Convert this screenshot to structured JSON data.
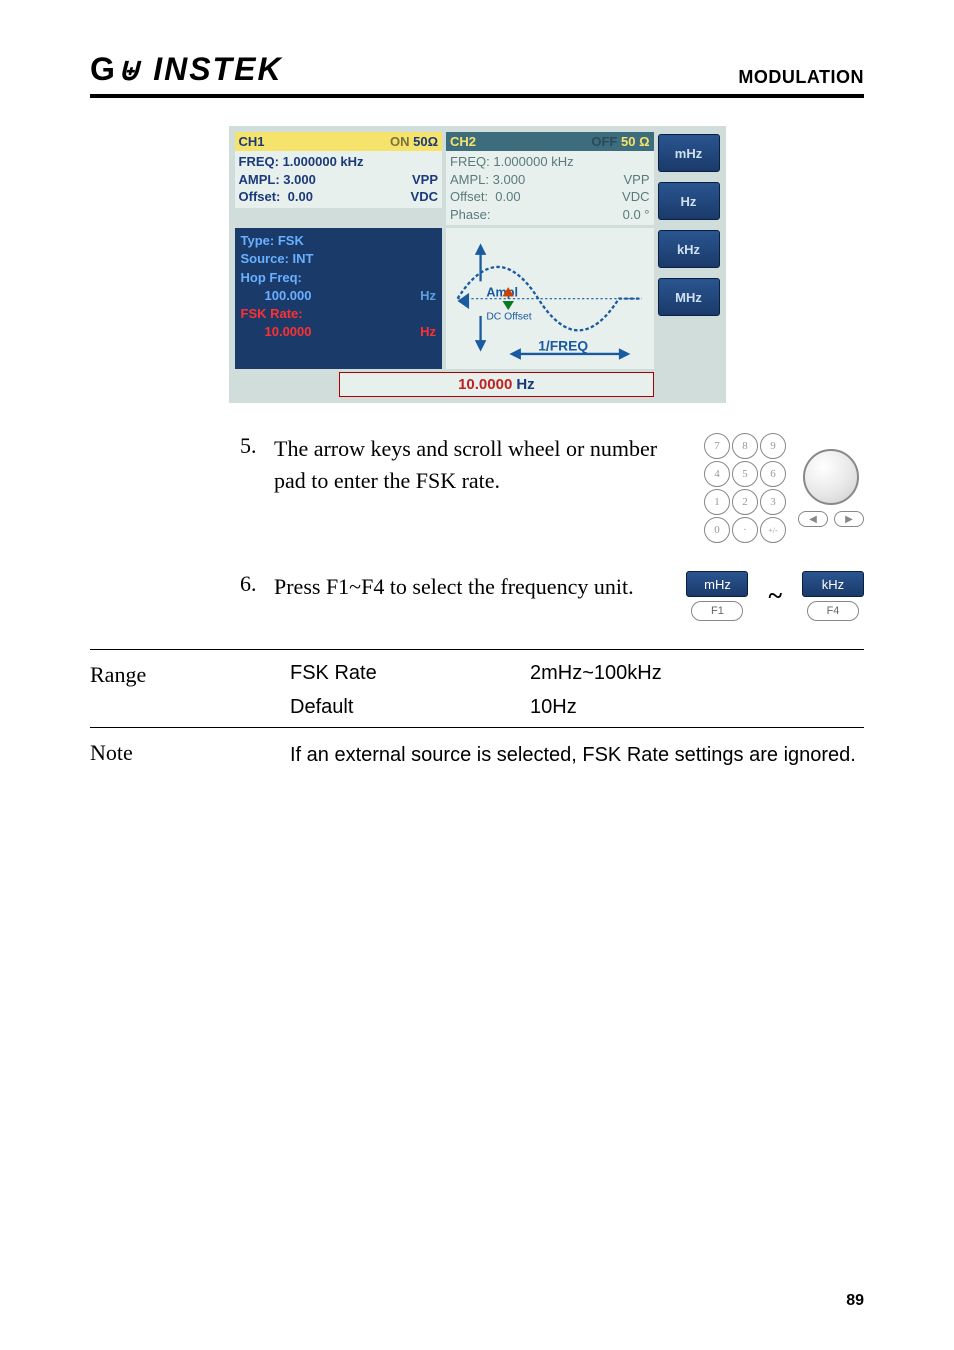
{
  "header": {
    "logo": "GWINSTEK",
    "title": "MODULATION"
  },
  "screenshot": {
    "ch1": {
      "head_label": "CH1",
      "head_on": "ON",
      "head_imp": "50Ω",
      "freq_label": "FREQ:",
      "freq_val": "1.000000 kHz",
      "ampl_label": "AMPL:",
      "ampl_val": "3.000",
      "ampl_unit": "VPP",
      "offset_label": "Offset:",
      "offset_val": "0.00",
      "offset_unit": "VDC"
    },
    "ch2": {
      "head_label": "CH2",
      "head_off": "OFF",
      "head_imp": "50 Ω",
      "freq_label": "FREQ:",
      "freq_val": "1.000000 kHz",
      "ampl_label": "AMPL:",
      "ampl_val": "3.000",
      "ampl_unit": "VPP",
      "offset_label": "Offset:",
      "offset_val": "0.00",
      "offset_unit": "VDC",
      "phase_label": "Phase:",
      "phase_val": "0.0 °"
    },
    "mod": {
      "type_label": "Type:",
      "type_val": "FSK",
      "src_label": "Source:",
      "src_val": "INT",
      "hop_label": "Hop Freq:",
      "hop_val": "100.000",
      "hop_unit": "Hz",
      "rate_label": "FSK Rate:",
      "rate_val": "10.0000",
      "rate_unit": "Hz"
    },
    "wave": {
      "ampl": "Ampl",
      "dcoff": "DC Offset",
      "freq": "1/FREQ"
    },
    "readout": {
      "value": "10.0000",
      "unit": "Hz"
    },
    "buttons": {
      "f1": "mHz",
      "f2": "Hz",
      "f3": "kHz",
      "f4": "MHz"
    }
  },
  "steps": {
    "s5": {
      "num": "5.",
      "text": "The arrow keys and scroll wheel or number pad to enter the FSK rate."
    },
    "s6": {
      "num": "6.",
      "text": "Press F1~F4 to select the frequency unit.",
      "btn1": "mHz",
      "btn1_key": "F1",
      "btn4": "kHz",
      "btn4_key": "F4"
    }
  },
  "keypad": [
    "7",
    "8",
    "9",
    "4",
    "5",
    "6",
    "1",
    "2",
    "3",
    "0",
    "·",
    "+/-"
  ],
  "range": {
    "label": "Range",
    "r1_name": "FSK Rate",
    "r1_val": "2mHz~100kHz",
    "r2_name": "Default",
    "r2_val": "10Hz"
  },
  "note": {
    "label": "Note",
    "text": "If an external source is selected, FSK Rate settings are ignored."
  },
  "page": "89"
}
